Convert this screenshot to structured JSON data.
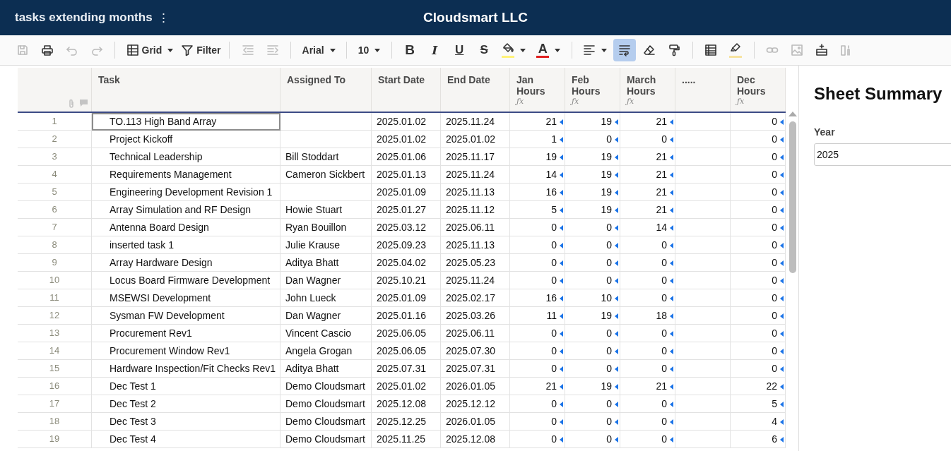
{
  "topbar": {
    "sheet_name": "tasks extending months",
    "menu_glyph": "⋮",
    "company": "Cloudsmart LLC"
  },
  "toolbar": [
    {
      "kind": "button",
      "disabled": true,
      "selected": false
    },
    {
      "kind": "button",
      "disabled": false,
      "selected": false
    },
    {
      "kind": "button",
      "disabled": true,
      "selected": false
    },
    {
      "kind": "button",
      "disabled": true,
      "selected": false
    },
    {
      "kind": "separator"
    },
    {
      "kind": "dropdown",
      "label": "Grid"
    },
    {
      "kind": "button",
      "label": "Filter",
      "disabled": false,
      "selected": false
    },
    {
      "kind": "separator"
    },
    {
      "kind": "button",
      "disabled": true,
      "selected": false
    },
    {
      "kind": "button",
      "disabled": true,
      "selected": false
    },
    {
      "kind": "separator"
    },
    {
      "kind": "dropdown",
      "label": "Arial"
    },
    {
      "kind": "separator"
    },
    {
      "kind": "dropdown",
      "label": "10"
    },
    {
      "kind": "separator"
    },
    {
      "kind": "button",
      "glyph": "B",
      "disabled": false,
      "selected": false
    },
    {
      "kind": "button",
      "glyph": "I",
      "disabled": false,
      "selected": false
    },
    {
      "kind": "button",
      "glyph": "U",
      "disabled": false,
      "selected": false
    },
    {
      "kind": "button",
      "glyph": "S",
      "disabled": false,
      "selected": false
    },
    {
      "kind": "dropdown",
      "color": "#fff27a"
    },
    {
      "kind": "dropdown",
      "glyph": "A",
      "color": "#e02020"
    },
    {
      "kind": "separator"
    },
    {
      "kind": "dropdown"
    },
    {
      "kind": "button",
      "disabled": false,
      "selected": true
    },
    {
      "kind": "button",
      "disabled": false,
      "selected": false
    },
    {
      "kind": "button",
      "disabled": false,
      "selected": false
    },
    {
      "kind": "separator"
    },
    {
      "kind": "button",
      "disabled": false,
      "selected": false
    },
    {
      "kind": "button",
      "disabled": false,
      "selected": false,
      "color": "#f7e3a0"
    },
    {
      "kind": "separator"
    },
    {
      "kind": "button",
      "disabled": true,
      "selected": false
    },
    {
      "kind": "button",
      "disabled": true,
      "selected": false
    },
    {
      "kind": "button",
      "disabled": false,
      "selected": false
    },
    {
      "kind": "button",
      "disabled": true,
      "selected": false
    }
  ],
  "table": {
    "columns": [
      {
        "kind": "text",
        "title": "Task"
      },
      {
        "kind": "text",
        "title": "Assigned To"
      },
      {
        "kind": "text",
        "title": "Start Date"
      },
      {
        "kind": "text",
        "title": "End Date"
      },
      {
        "kind": "hours",
        "title": "Jan Hours",
        "formula_glyph": "ƒx"
      },
      {
        "kind": "hours",
        "title": "Feb Hours",
        "formula_glyph": "ƒx"
      },
      {
        "kind": "hours",
        "title": "March Hours",
        "formula_glyph": "ƒx"
      },
      {
        "kind": "blank",
        "title": "....."
      },
      {
        "kind": "hours",
        "title": "Dec Hours",
        "formula_glyph": "ƒx"
      }
    ],
    "rows": [
      {
        "number": "1",
        "task": "TO.113 High Band Array",
        "start": "2025.01.02",
        "end": "2025.11.24",
        "hours": [
          "21",
          "19",
          "21",
          "0"
        ],
        "task_selected": true
      },
      {
        "number": "2",
        "task": "Project Kickoff",
        "start": "2025.01.02",
        "end": "2025.01.02",
        "hours": [
          "1",
          "0",
          "0",
          "0"
        ],
        "task_selected": false
      },
      {
        "number": "3",
        "task": "Technical Leadership",
        "assigned": "Bill Stoddart",
        "start": "2025.01.06",
        "end": "2025.11.17",
        "hours": [
          "19",
          "19",
          "21",
          "0"
        ],
        "task_selected": false
      },
      {
        "number": "4",
        "task": "Requirements Management",
        "assigned": "Cameron Sickbert",
        "start": "2025.01.13",
        "end": "2025.11.24",
        "hours": [
          "14",
          "19",
          "21",
          "0"
        ],
        "task_selected": false
      },
      {
        "number": "5",
        "task": "Engineering Development Revision 1",
        "start": "2025.01.09",
        "end": "2025.11.13",
        "hours": [
          "16",
          "19",
          "21",
          "0"
        ],
        "task_selected": false
      },
      {
        "number": "6",
        "task": "Array Simulation and RF Design",
        "assigned": "Howie Stuart",
        "start": "2025.01.27",
        "end": "2025.11.12",
        "hours": [
          "5",
          "19",
          "21",
          "0"
        ],
        "task_selected": false
      },
      {
        "number": "7",
        "task": "Antenna Board Design",
        "assigned": "Ryan Bouillon",
        "start": "2025.03.12",
        "end": "2025.06.11",
        "hours": [
          "0",
          "0",
          "14",
          "0"
        ],
        "task_selected": false
      },
      {
        "number": "8",
        "task": "inserted task 1",
        "assigned": "Julie Krause",
        "start": "2025.09.23",
        "end": "2025.11.13",
        "hours": [
          "0",
          "0",
          "0",
          "0"
        ],
        "task_selected": false
      },
      {
        "number": "9",
        "task": "Array Hardware Design",
        "assigned": "Aditya Bhatt",
        "start": "2025.04.02",
        "end": "2025.05.23",
        "hours": [
          "0",
          "0",
          "0",
          "0"
        ],
        "task_selected": false
      },
      {
        "number": "10",
        "task": "Locus Board Firmware Development",
        "assigned": "Dan Wagner",
        "start": "2025.10.21",
        "end": "2025.11.24",
        "hours": [
          "0",
          "0",
          "0",
          "0"
        ],
        "task_selected": false
      },
      {
        "number": "11",
        "task": "MSEWSI Development",
        "assigned": "John Lueck",
        "start": "2025.01.09",
        "end": "2025.02.17",
        "hours": [
          "16",
          "10",
          "0",
          "0"
        ],
        "task_selected": false
      },
      {
        "number": "12",
        "task": "Sysman FW Development",
        "assigned": "Dan Wagner",
        "start": "2025.01.16",
        "end": "2025.03.26",
        "hours": [
          "11",
          "19",
          "18",
          "0"
        ],
        "task_selected": false
      },
      {
        "number": "13",
        "task": "Procurement Rev1",
        "assigned": "Vincent Cascio",
        "start": "2025.06.05",
        "end": "2025.06.11",
        "hours": [
          "0",
          "0",
          "0",
          "0"
        ],
        "task_selected": false
      },
      {
        "number": "14",
        "task": "Procurement Window Rev1",
        "assigned": "Angela Grogan",
        "start": "2025.06.05",
        "end": "2025.07.30",
        "hours": [
          "0",
          "0",
          "0",
          "0"
        ],
        "task_selected": false
      },
      {
        "number": "15",
        "task": "Hardware Inspection/Fit Checks Rev1",
        "assigned": "Aditya Bhatt",
        "start": "2025.07.31",
        "end": "2025.07.31",
        "hours": [
          "0",
          "0",
          "0",
          "0"
        ],
        "task_selected": false
      },
      {
        "number": "16",
        "task": "Dec Test 1",
        "assigned": "Demo Cloudsmart",
        "start": "2025.01.02",
        "end": "2026.01.05",
        "hours": [
          "21",
          "19",
          "21",
          "22"
        ],
        "task_selected": false
      },
      {
        "number": "17",
        "task": "Dec Test 2",
        "assigned": "Demo Cloudsmart",
        "start": "2025.12.08",
        "end": "2025.12.12",
        "hours": [
          "0",
          "0",
          "0",
          "5"
        ],
        "task_selected": false
      },
      {
        "number": "18",
        "task": "Dec Test 3",
        "assigned": "Demo Cloudsmart",
        "start": "2025.12.25",
        "end": "2026.01.05",
        "hours": [
          "0",
          "0",
          "0",
          "4"
        ],
        "task_selected": false
      },
      {
        "number": "19",
        "task": "Dec Test 4",
        "assigned": "Demo Cloudsmart",
        "start": "2025.11.25",
        "end": "2025.12.08",
        "hours": [
          "0",
          "0",
          "0",
          "6"
        ],
        "task_selected": false
      }
    ]
  },
  "summary": {
    "title": "Sheet Summary",
    "year_label": "Year",
    "year_value": "2025"
  }
}
